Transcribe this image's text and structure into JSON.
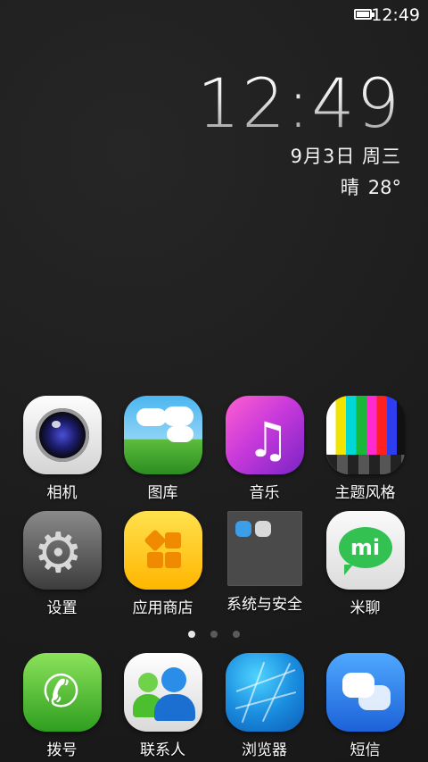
{
  "status_bar": {
    "time": "12:49",
    "battery_icon": "battery-icon",
    "battery_level": 1.0
  },
  "clock_widget": {
    "time": "12:49",
    "date": "9月3日 周三",
    "weather": "晴",
    "temperature": "28°"
  },
  "home_apps": [
    {
      "label": "相机",
      "icon": "camera-icon"
    },
    {
      "label": "图库",
      "icon": "gallery-icon"
    },
    {
      "label": "音乐",
      "icon": "music-icon"
    },
    {
      "label": "主题风格",
      "icon": "theme-icon"
    },
    {
      "label": "设置",
      "icon": "settings-gear-icon"
    },
    {
      "label": "应用商店",
      "icon": "app-store-icon"
    },
    {
      "label": "系统与安全",
      "icon": "folder-icon"
    },
    {
      "label": "米聊",
      "icon": "miliao-chat-icon"
    }
  ],
  "page_indicator": {
    "pages": 3,
    "current": 1
  },
  "dock_apps": [
    {
      "label": "拨号",
      "icon": "phone-icon"
    },
    {
      "label": "联系人",
      "icon": "contacts-icon"
    },
    {
      "label": "浏览器",
      "icon": "browser-icon"
    },
    {
      "label": "短信",
      "icon": "sms-icon"
    }
  ],
  "miliao_logo_text": "mi"
}
